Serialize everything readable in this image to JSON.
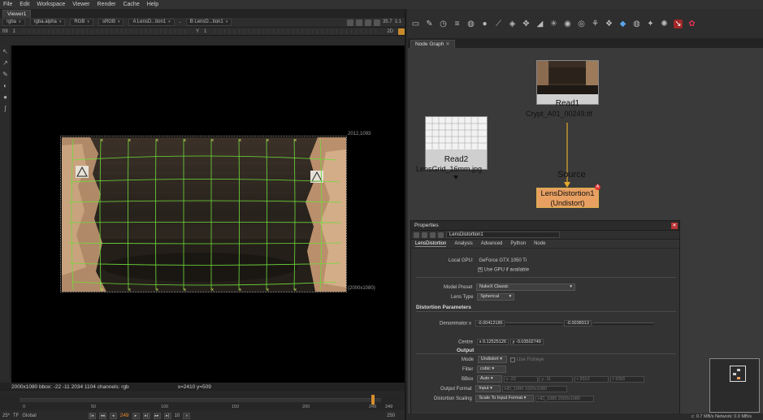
{
  "menu": [
    "File",
    "Edit",
    "Workspace",
    "Viewer",
    "Render",
    "Cache",
    "Help"
  ],
  "viewer": {
    "tab": "Viewer1",
    "channels": "rgba",
    "alpha": "rgba.alpha",
    "colorspace": "RGB",
    "lut": "sRGB",
    "input_a": "A  LensD...tion1",
    "input_a_op": "-",
    "input_b": "B  LensD...tion1",
    "fstop": "f/8",
    "gain": "1",
    "gamma_label": "Y",
    "gamma": "1",
    "zoom": "35.7",
    "proxy": "1:1",
    "view_mode": "2D",
    "format_tr": "2012,1093",
    "format_br": "(2000x1080)",
    "info_bbox": "2000x1080  bbox: -22 -11 2034 1104 channels: rgb",
    "info_coords": "x=2410 y=509"
  },
  "timeline": {
    "ticks": [
      "0",
      "50",
      "100",
      "150",
      "200",
      "249"
    ],
    "end_frame": "249",
    "fps": "25*",
    "tf": "TF",
    "range": "Global",
    "current_frame": "249",
    "skip": "10",
    "end": "250",
    "progress": 0.996
  },
  "right_toolbar_icons": [
    "image-icon",
    "draw-icon",
    "time-icon",
    "channel-icon",
    "color-icon",
    "filter-icon",
    "keyer-icon",
    "merge-icon",
    "transform-icon",
    "3d-icon",
    "particles-icon",
    "deep-icon",
    "views-icon",
    "metadata-icon",
    "toolsets-icon",
    "other-icon",
    "furnace-icon",
    "ofx-icon",
    "gizmo-icon"
  ],
  "node_graph": {
    "tab": "Node Graph",
    "read1": {
      "label": "Read1",
      "file": "Crypt_A01_00249.tif"
    },
    "read2": {
      "label": "Read2",
      "file": "LensGrid_16mm.jpg"
    },
    "pipe_label": "Source",
    "lensdistortion": {
      "label": "LensDistortion1",
      "mode": "(Undistort)"
    }
  },
  "properties": {
    "title": "Properties",
    "node_name": "LensDistortion1",
    "tabs": [
      "LensDistortion",
      "Analysis",
      "Advanced",
      "Python",
      "Node"
    ],
    "local_gpu_label": "Local GPU:",
    "local_gpu": "GeForce GTX 1050 Ti",
    "use_gpu": "Use GPU if available",
    "model_preset_label": "Model Preset",
    "model_preset": "NukeX Classic",
    "lens_type_label": "Lens Type",
    "lens_type": "Spherical",
    "distortion_params": "Distortion Parameters",
    "denominator_label": "Denominator x",
    "denominator_x": "-0.00412185",
    "denominator_y": "-0.0038913",
    "centre_label": "Centre",
    "centre_x": "x 0.12525126",
    "centre_y": "y -0.03502749",
    "output_label": "Output",
    "mode_label": "Mode",
    "mode": "Undistort",
    "use_fisheye": "Use Fisheye",
    "filter_label": "Filter",
    "filter": "cubic",
    "bbox_label": "BBox",
    "bbox": "Auto",
    "bbox_x": "x -22",
    "bbox_y": "y -11",
    "bbox_r": "r 2012",
    "bbox_t": "t 1093",
    "output_format_label": "Output Format",
    "output_format": "Input",
    "output_format_value": "HD_1080 1920x1080",
    "distortion_scaling_label": "Distortion Scaling",
    "distortion_scaling": "Scale To Input Format",
    "distortion_scaling_value": "HD_1080 2000x1080"
  },
  "status": "c: 0.7 MB/s  Network: 0.0 MB/s"
}
